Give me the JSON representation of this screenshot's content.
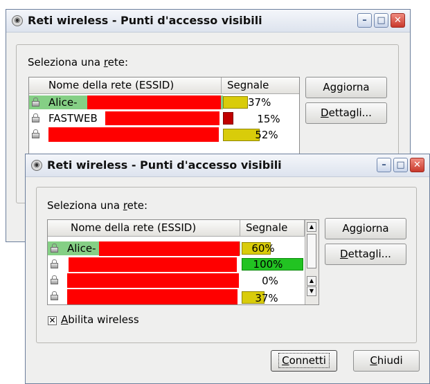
{
  "title": "Reti wireless - Punti d'accesso visibili",
  "title_buttons": {
    "minimize_icon": "minimize-icon",
    "maximize_icon": "maximize-icon",
    "close_icon": "close-icon"
  },
  "network_label_prefix": "Seleziona una ",
  "network_label_key": "r",
  "network_label_suffix": "ete:",
  "columns": {
    "essid": "Nome della rete (ESSID)",
    "signal": "Segnale"
  },
  "buttons": {
    "refresh": "Aggiorna",
    "details_key": "D",
    "details_rest": "ettagli...",
    "connect_key": "C",
    "connect_rest": "onnetti",
    "close_key": "C",
    "close_rest": "hiudi"
  },
  "checkbox": {
    "key": "A",
    "rest": "bilita wireless",
    "checked": true
  },
  "back_window": {
    "networks": [
      {
        "essid": "Alice-",
        "signal_text": "37%",
        "signal": 37,
        "selected": true
      },
      {
        "essid": "FASTWEB",
        "signal_text": "15%",
        "signal": 15
      },
      {
        "essid": "",
        "signal_text": "52%",
        "signal": 52
      }
    ]
  },
  "front_window": {
    "networks": [
      {
        "essid": "Alice-",
        "signal_text": "60%",
        "signal": 60,
        "selected": true
      },
      {
        "essid": "",
        "signal_text": "100%",
        "signal": 100
      },
      {
        "essid": "",
        "signal_text": "0%",
        "signal": 0
      },
      {
        "essid": "",
        "signal_text": "37%",
        "signal": 37
      }
    ]
  },
  "colors": {
    "signal_yellow": "#d9cc0a",
    "signal_green": "#22c322",
    "signal_red": "#c00000",
    "redaction": "#ff0000",
    "selection": "#85cf85"
  }
}
